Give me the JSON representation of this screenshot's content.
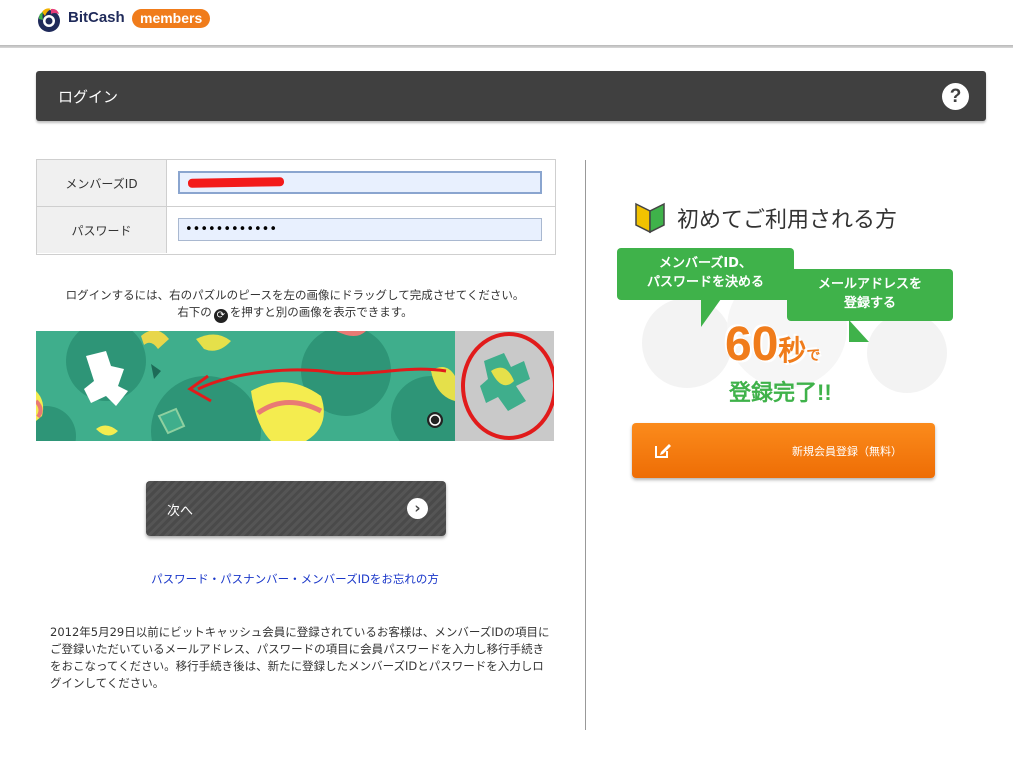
{
  "header": {
    "logo_text": "BitCash",
    "badge": "members"
  },
  "titlebar": {
    "title": "ログイン",
    "help": "?"
  },
  "form": {
    "member_id_label": "メンバーズID",
    "member_id_value": "",
    "password_label": "パスワード",
    "password_value": "••••••••••••"
  },
  "captcha": {
    "line1": "ログインするには、右のパズルのピースを左の画像にドラッグして完成させてください。",
    "line2_before": "右下の",
    "line2_after": "を押すと別の画像を表示できます。"
  },
  "next_button": {
    "label": "次へ"
  },
  "forgot_link": "パスワード・パスナンバー・メンバーズIDをお忘れの方",
  "note": "2012年5月29日以前にビットキャッシュ会員に登録されているお客様は、メンバーズIDの項目にご登録いただいているメールアドレス、パスワードの項目に会員パスワードを入力し移行手続きをおこなってください。移行手続き後は、新たに登録したメンバーズIDとパスワードを入力しログインしてください。",
  "first_time": {
    "heading": "初めてご利用される方"
  },
  "promo": {
    "bubble1_line1": "メンバーズID、",
    "bubble1_line2": "パスワードを決める",
    "bubble2_line1": "メールアドレスを",
    "bubble2_line2": "登録する",
    "seconds_number": "60",
    "seconds_unit": "秒",
    "seconds_de": "で",
    "complete": "登録完了!!"
  },
  "register_button": {
    "label": "新規会員登録（無料）"
  },
  "colors": {
    "orange": "#f07c1b",
    "green": "#3fb24a",
    "dark": "#404040",
    "link": "#1a37c9"
  }
}
